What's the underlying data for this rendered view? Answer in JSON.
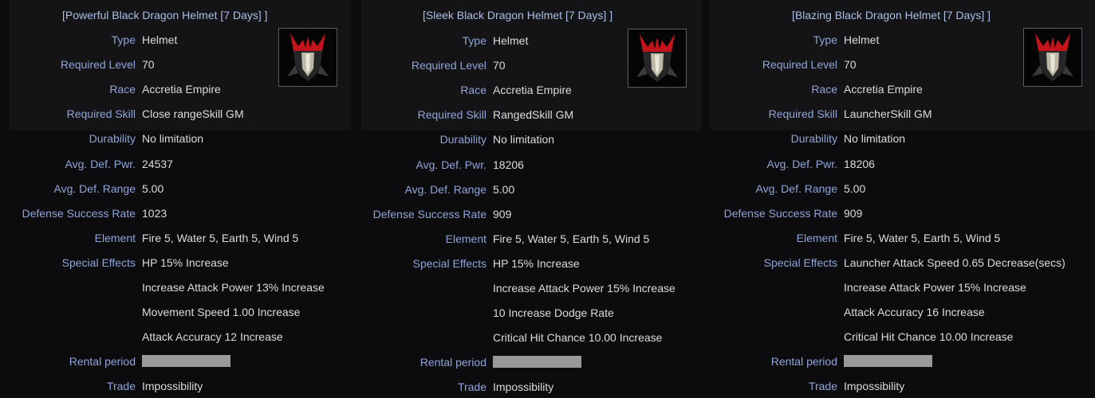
{
  "tooltips": [
    {
      "title": "[Powerful Black Dragon Helmet [7 Days] ]",
      "icon": "black-dragon-helmet-icon",
      "rows": [
        {
          "label": "Type",
          "value": "Helmet"
        },
        {
          "label": "Required Level",
          "value": "70"
        },
        {
          "label": "Race",
          "value": "Accretia Empire"
        },
        {
          "label": "Required Skill",
          "value": "Close rangeSkill GM"
        },
        {
          "label": "Durability",
          "value": "No limitation"
        },
        {
          "label": "Avg. Def. Pwr.",
          "value": "24537"
        },
        {
          "label": "Avg. Def. Range",
          "value": "5.00"
        },
        {
          "label": "Defense Success Rate",
          "value": "1023"
        },
        {
          "label": "Element",
          "value": "Fire 5, Water 5, Earth 5, Wind 5"
        },
        {
          "label": "Special Effects",
          "value": "HP 15% Increase"
        },
        {
          "label": "",
          "value": "Increase Attack Power 13% Increase"
        },
        {
          "label": "",
          "value": "Movement Speed 1.00 Increase"
        },
        {
          "label": "",
          "value": "Attack Accuracy 12 Increase"
        },
        {
          "label": "Rental period",
          "value": ""
        },
        {
          "label": "Trade",
          "value": "Impossibility"
        }
      ]
    },
    {
      "title": "[Sleek Black Dragon Helmet [7 Days] ]",
      "icon": "black-dragon-helmet-icon",
      "rows": [
        {
          "label": "Type",
          "value": "Helmet"
        },
        {
          "label": "Required Level",
          "value": "70"
        },
        {
          "label": "Race",
          "value": "Accretia Empire"
        },
        {
          "label": "Required Skill",
          "value": "RangedSkill GM"
        },
        {
          "label": "Durability",
          "value": "No limitation"
        },
        {
          "label": "Avg. Def. Pwr.",
          "value": "18206"
        },
        {
          "label": "Avg. Def. Range",
          "value": "5.00"
        },
        {
          "label": "Defense Success Rate",
          "value": "909"
        },
        {
          "label": "Element",
          "value": "Fire 5, Water 5, Earth 5, Wind 5"
        },
        {
          "label": "Special Effects",
          "value": "HP 15% Increase"
        },
        {
          "label": "",
          "value": "Increase Attack Power 15% Increase"
        },
        {
          "label": "",
          "value": "10 Increase Dodge Rate"
        },
        {
          "label": "",
          "value": "Critical Hit Chance 10.00 Increase"
        },
        {
          "label": "Rental period",
          "value": ""
        },
        {
          "label": "Trade",
          "value": "Impossibility"
        }
      ]
    },
    {
      "title": "[Blazing Black Dragon Helmet [7 Days] ]",
      "icon": "black-dragon-helmet-icon",
      "rows": [
        {
          "label": "Type",
          "value": "Helmet"
        },
        {
          "label": "Required Level",
          "value": "70"
        },
        {
          "label": "Race",
          "value": "Accretia Empire"
        },
        {
          "label": "Required Skill",
          "value": "LauncherSkill GM"
        },
        {
          "label": "Durability",
          "value": "No limitation"
        },
        {
          "label": "Avg. Def. Pwr.",
          "value": "18206"
        },
        {
          "label": "Avg. Def. Range",
          "value": "5.00"
        },
        {
          "label": "Defense Success Rate",
          "value": "909"
        },
        {
          "label": "Element",
          "value": "Fire 5, Water 5, Earth 5, Wind 5"
        },
        {
          "label": "Special Effects",
          "value": "Launcher Attack Speed 0.65 Decrease(secs)"
        },
        {
          "label": "",
          "value": "Increase Attack Power 15% Increase"
        },
        {
          "label": "",
          "value": "Attack Accuracy 16 Increase"
        },
        {
          "label": "",
          "value": "Critical Hit Chance 10.00 Increase"
        },
        {
          "label": "Rental period",
          "value": ""
        },
        {
          "label": "Trade",
          "value": "Impossibility"
        }
      ]
    }
  ]
}
